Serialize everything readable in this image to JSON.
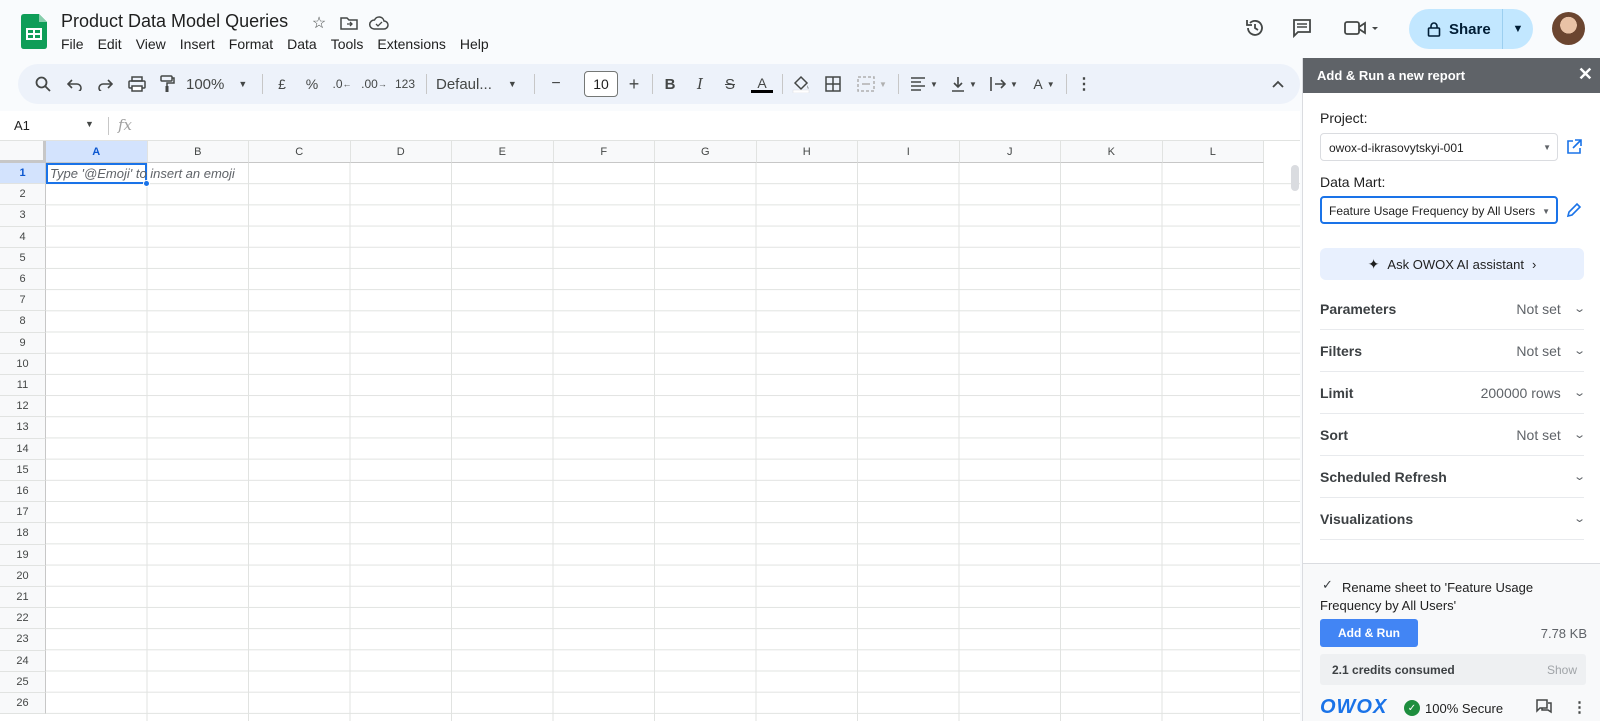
{
  "doc": {
    "title": "Product Data Model Queries",
    "menu": [
      "File",
      "Edit",
      "View",
      "Insert",
      "Format",
      "Data",
      "Tools",
      "Extensions",
      "Help"
    ]
  },
  "header": {
    "share_label": "Share"
  },
  "toolbar": {
    "zoom": "100%",
    "currency": "£",
    "percent": "%",
    "dec_less": ".0",
    "dec_more": ".00",
    "number_format": "123",
    "font": "Defaul...",
    "font_size": "10"
  },
  "formula_bar": {
    "cell_ref": "A1",
    "fx": "fx"
  },
  "grid": {
    "columns": [
      "A",
      "B",
      "C",
      "D",
      "E",
      "F",
      "G",
      "H",
      "I",
      "J",
      "K",
      "L"
    ],
    "rows": [
      "1",
      "2",
      "3",
      "4",
      "5",
      "6",
      "7",
      "8",
      "9",
      "10",
      "11",
      "12",
      "13",
      "14",
      "15",
      "16",
      "17",
      "18",
      "19",
      "20",
      "21",
      "22",
      "23",
      "24",
      "25",
      "26"
    ],
    "hint": "Type '@Emoji' to insert an emoji"
  },
  "panel": {
    "title": "Add & Run a new report",
    "project_label": "Project:",
    "project_value": "owox-d-ikrasovytskyi-001",
    "datamart_label": "Data Mart:",
    "datamart_value": "Feature Usage Frequency by All Users",
    "ai_button": "Ask OWOX AI assistant",
    "rows": [
      {
        "label": "Parameters",
        "value": "Not set"
      },
      {
        "label": "Filters",
        "value": "Not set"
      },
      {
        "label": "Limit",
        "value": "200000 rows"
      },
      {
        "label": "Sort",
        "value": "Not set"
      },
      {
        "label": "Scheduled Refresh",
        "value": ""
      },
      {
        "label": "Visualizations",
        "value": ""
      }
    ],
    "rename_text": "Rename sheet to 'Feature Usage Frequency by All Users'",
    "add_run": "Add & Run",
    "size": "7.78 KB",
    "credits": "2.1 credits consumed",
    "credits_show": "Show",
    "brand": "OWOX",
    "secure": "100% Secure"
  },
  "colors": {
    "accent": "#1a73e8",
    "share_bg": "#c2e7ff",
    "panel_header": "#5f6368",
    "sheets_green": "#0f9d58"
  }
}
